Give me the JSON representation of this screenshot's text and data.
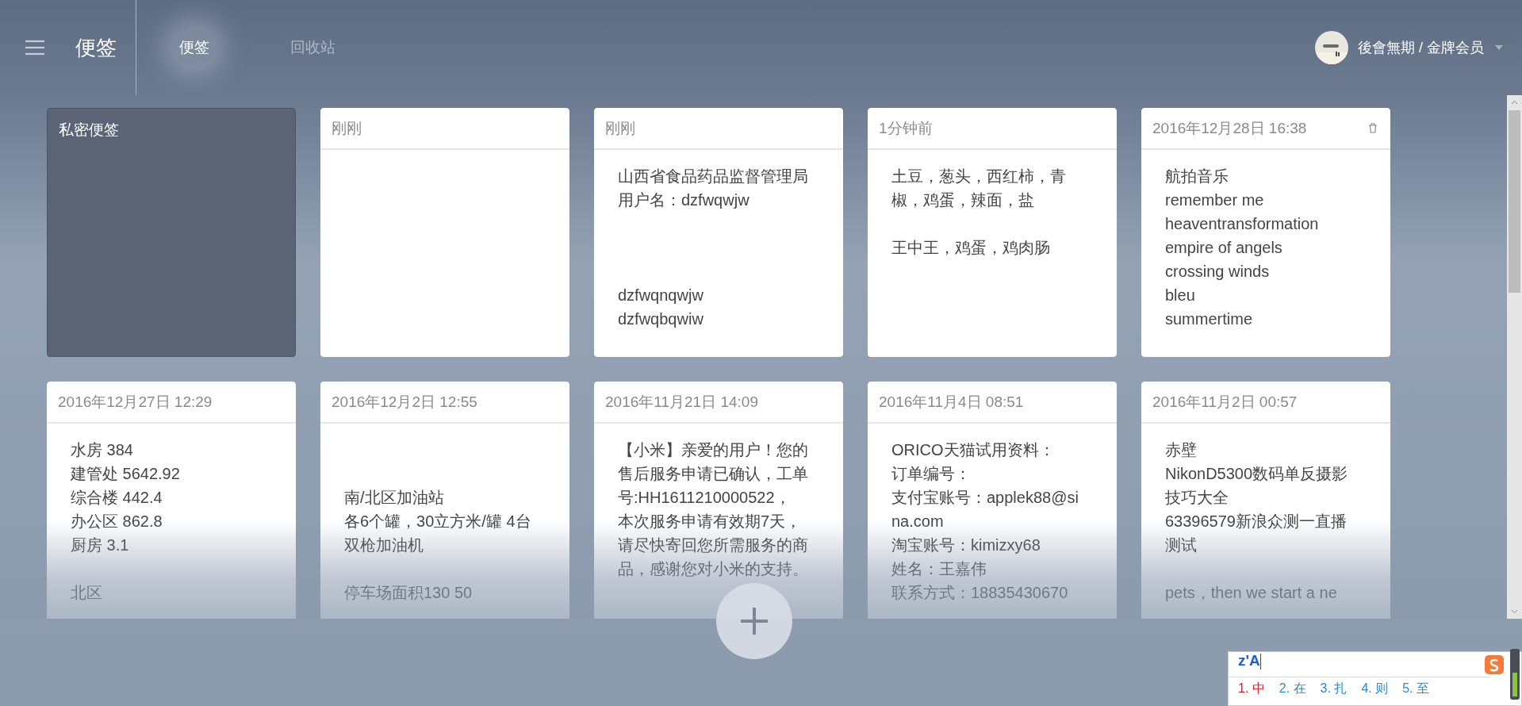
{
  "header": {
    "title": "便签",
    "tabs": [
      {
        "label": "便签",
        "selected": true
      },
      {
        "label": "回收站",
        "selected": false
      }
    ],
    "user": {
      "name": "後會無期 / 金牌会员"
    }
  },
  "notes": [
    {
      "kind": "private",
      "title": "私密便签"
    },
    {
      "kind": "note",
      "time": "刚刚",
      "show_delete": false
    },
    {
      "kind": "note",
      "time": "刚刚",
      "show_delete": false,
      "blocks": [
        {
          "kind": "plain",
          "lines": [
            "山西省食品药品监督管理局",
            "用户名：dzfwqwjw"
          ]
        },
        {
          "kind": "gap3",
          "lines": [
            "dzfwqnqwjw",
            "dzfwqbqwiw"
          ]
        }
      ]
    },
    {
      "kind": "note",
      "time": "1分钟前",
      "show_delete": false,
      "blocks": [
        {
          "kind": "plain",
          "lines": [
            "土豆，葱头，西红柿，青",
            "椒，鸡蛋，辣面，盐"
          ]
        },
        {
          "kind": "gap1",
          "lines": [
            "王中王，鸡蛋，鸡肉肠"
          ]
        }
      ]
    },
    {
      "kind": "note",
      "time": "2016年12月28日 16:38",
      "show_delete": true,
      "blocks": [
        {
          "kind": "plain",
          "lines": [
            "航拍音乐",
            "remember me",
            "heaventransformation",
            "empire of angels",
            "crossing winds",
            "bleu",
            "summertime"
          ]
        }
      ]
    },
    {
      "kind": "note",
      "time": "2016年12月27日 12:29",
      "show_delete": false,
      "blocks": [
        {
          "kind": "plain",
          "lines": [
            "水房 384",
            "建管处 5642.92",
            "综合楼 442.4",
            "办公区 862.8",
            "厨房 3.1"
          ]
        },
        {
          "kind": "gap1",
          "lines": [
            "北区"
          ]
        }
      ]
    },
    {
      "kind": "note",
      "time": "2016年12月2日 12:55",
      "show_delete": false,
      "blocks": [
        {
          "kind": "gap2",
          "lines": [
            "南/北区加油站",
            "各6个罐，30立方米/罐 4台",
            "双枪加油机"
          ]
        },
        {
          "kind": "gap1",
          "lines": [
            "停车场面积130 50"
          ]
        }
      ]
    },
    {
      "kind": "note",
      "time": "2016年11月21日 14:09",
      "show_delete": false,
      "blocks": [
        {
          "kind": "plain",
          "lines": [
            "【小米】亲爱的用户！您的",
            "售后服务申请已确认，工单",
            "号:HH1611210000522，",
            "本次服务申请有效期7天，",
            "请尽快寄回您所需服务的商",
            "品，感谢您对小米的支持。"
          ]
        }
      ]
    },
    {
      "kind": "note",
      "time": "2016年11月4日 08:51",
      "show_delete": false,
      "blocks": [
        {
          "kind": "plain",
          "lines": [
            "ORICO天猫试用资料：",
            "订单编号：",
            "支付宝账号：applek88@si",
            "na.com",
            "淘宝账号：kimizxy68",
            "姓名：王嘉伟",
            "联系方式：18835430670"
          ]
        }
      ]
    },
    {
      "kind": "note",
      "time": "2016年11月2日 00:57",
      "show_delete": false,
      "blocks": [
        {
          "kind": "plain",
          "lines": [
            "赤壁",
            "NikonD5300数码单反摄影",
            "技巧大全",
            "63396579新浪众测一直播",
            "测试"
          ]
        },
        {
          "kind": "gap1",
          "lines": [
            "pets，then we start a ne"
          ]
        }
      ]
    }
  ],
  "ime": {
    "input": "z'A",
    "candidates": [
      {
        "label": "1. 中",
        "selected": true
      },
      {
        "label": "2. 在",
        "selected": false
      },
      {
        "label": "3. 扎",
        "selected": false
      },
      {
        "label": "4. 则",
        "selected": false
      },
      {
        "label": "5. 至",
        "selected": false
      }
    ]
  }
}
